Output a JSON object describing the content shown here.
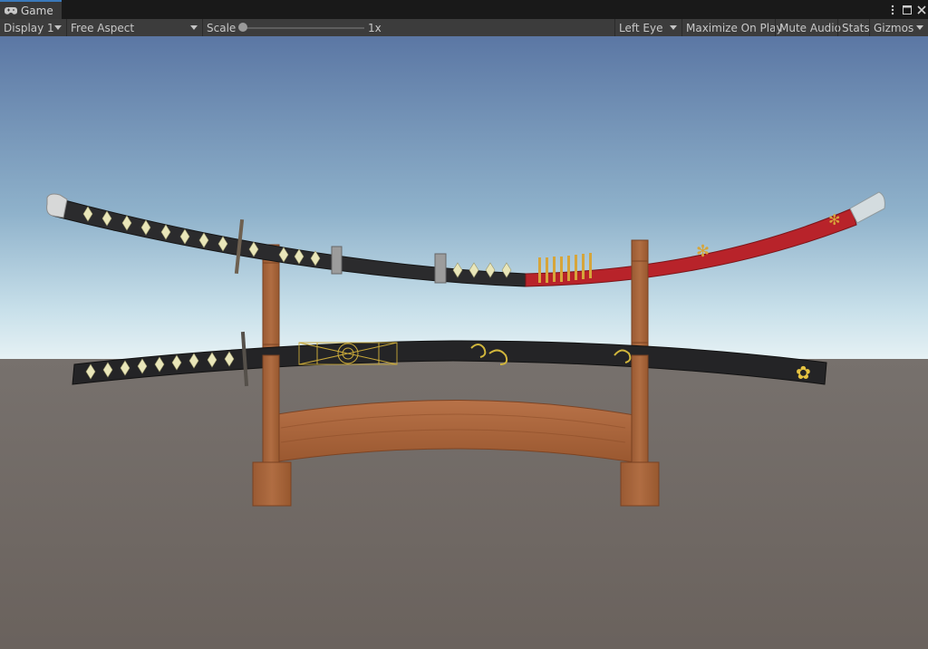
{
  "tab": {
    "label": "Game",
    "icon": "gamepad-icon"
  },
  "window_controls": {
    "menu_icon": "kebab-menu-icon",
    "maximize_icon": "maximize-icon",
    "close_icon": "close-icon"
  },
  "toolbar": {
    "display": "Display 1",
    "aspect": "Free Aspect",
    "scale_label": "Scale",
    "scale_value": "1x",
    "scale_slider_level": 0.0,
    "eye": "Left Eye",
    "maximize_on_play": "Maximize On Play",
    "mute_audio": "Mute Audio",
    "stats": "Stats",
    "gizmos": "Gizmos"
  },
  "scene": {
    "sky_top": "#5d7aa6",
    "sky_horizon": "#cfe3ec",
    "ground": "#6a625d",
    "wood": "#a5643b",
    "scabbard_black": "#262628",
    "scabbard_red": "#b8232a",
    "gold": "#d1b63c",
    "diamond": "#e9e6b9"
  }
}
